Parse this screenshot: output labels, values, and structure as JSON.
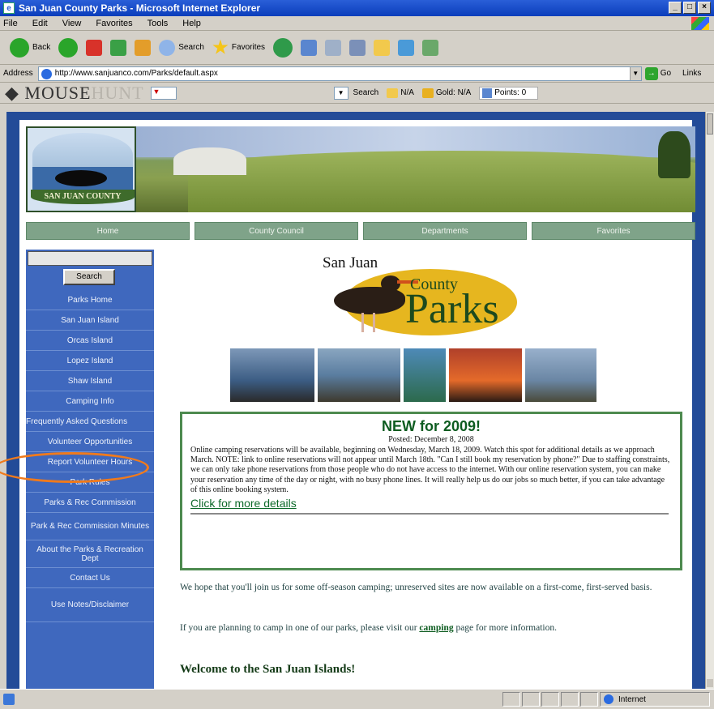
{
  "window": {
    "title": "San Juan County Parks - Microsoft Internet Explorer",
    "min": "_",
    "max": "□",
    "close": "×"
  },
  "menu": [
    "File",
    "Edit",
    "View",
    "Favorites",
    "Tools",
    "Help"
  ],
  "toolbar": {
    "back_label": "Back",
    "search_label": "Search",
    "favorites_label": "Favorites"
  },
  "address": {
    "label": "Address",
    "url": "http://www.sanjuanco.com/Parks/default.aspx",
    "go_label": "Go",
    "links_label": "Links"
  },
  "mousehunt": {
    "logo_main": "MOUSE",
    "logo_fade": "HUNT",
    "search_label": "Search",
    "rank": "N/A",
    "gold": "Gold: N/A",
    "points": "Points: 0"
  },
  "site": {
    "logo_text": "SAN JUAN COUNTY",
    "nav": [
      "Home",
      "County Council",
      "Departments",
      "Favorites"
    ],
    "search_button": "Search",
    "sidebar": [
      "Parks Home",
      "San Juan Island",
      "Orcas Island",
      "Lopez Island",
      "Shaw Island",
      "Camping Info",
      "Frequently Asked Questions",
      "Volunteer Opportunities",
      "Report Volunteer Hours",
      "Park Rules",
      "Parks & Rec Commission",
      "Park & Rec Commission Minutes",
      "About the Parks & Recreation Dept",
      "Contact Us",
      "Use Notes/Disclaimer"
    ],
    "parks_logo": {
      "san_juan": "San Juan",
      "county": "County",
      "parks": "Parks"
    },
    "news": {
      "title": "NEW for 2009!",
      "posted": "Posted: December 8, 2008",
      "body": "Online camping reservations will be available, beginning on Wednesday, March 18, 2009. Watch this spot for additional details as we approach March. NOTE: link to online reservations will not appear until March 18th. \"Can I still book my reservation by phone?\" Due to staffing constraints, we can only take phone reservations from those people who do not have access to the internet. With our online reservation system, you can make your reservation any time of the day or night, with no busy phone lines. It will really help us do our jobs so much better, if you can take advantage of this online booking system.",
      "link": "Click for more details"
    },
    "para1": "We hope that you'll join us for some off-season camping; unreserved sites are now available on a first-come, first-served basis.",
    "para2_before": "If you are planning to camp in one of our parks, please visit our",
    "para2_link": "camping",
    "para2_after": "page for more information.",
    "welcome": "Welcome to the San Juan Islands!"
  },
  "status": {
    "zone": "Internet"
  },
  "colors": {
    "page_bg": "#234b98",
    "sidebar": "#3f68be",
    "nav_tab": "#7fa389",
    "news_border": "#4d8a4f",
    "highlight": "#f07a1c"
  }
}
